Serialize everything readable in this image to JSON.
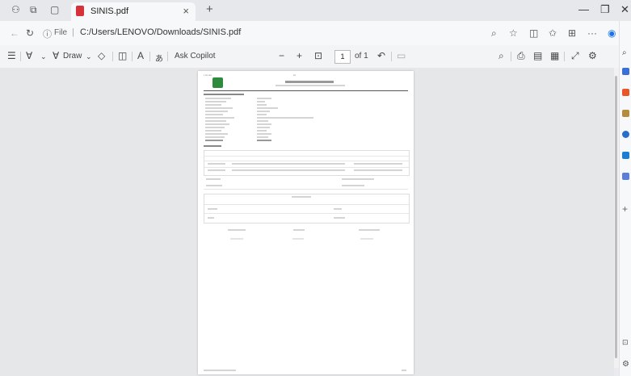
{
  "tab": {
    "title": "SINIS.pdf",
    "close": "×",
    "new": "+"
  },
  "address": {
    "info": "ⓘ",
    "file_label": "File",
    "sep": "|",
    "url": "C:/Users/LENOVO/Downloads/SINIS.pdf"
  },
  "pdf_toolbar": {
    "draw_label": "Draw",
    "ask_copilot": "Ask Copilot",
    "minus": "−",
    "plus": "+",
    "page_current": "1",
    "page_total": "of 1",
    "read_aloud": "A"
  },
  "colors": {
    "accent": "#0b62b5",
    "pdf_red": "#d6323a",
    "logo_green": "#2e8b3d"
  }
}
